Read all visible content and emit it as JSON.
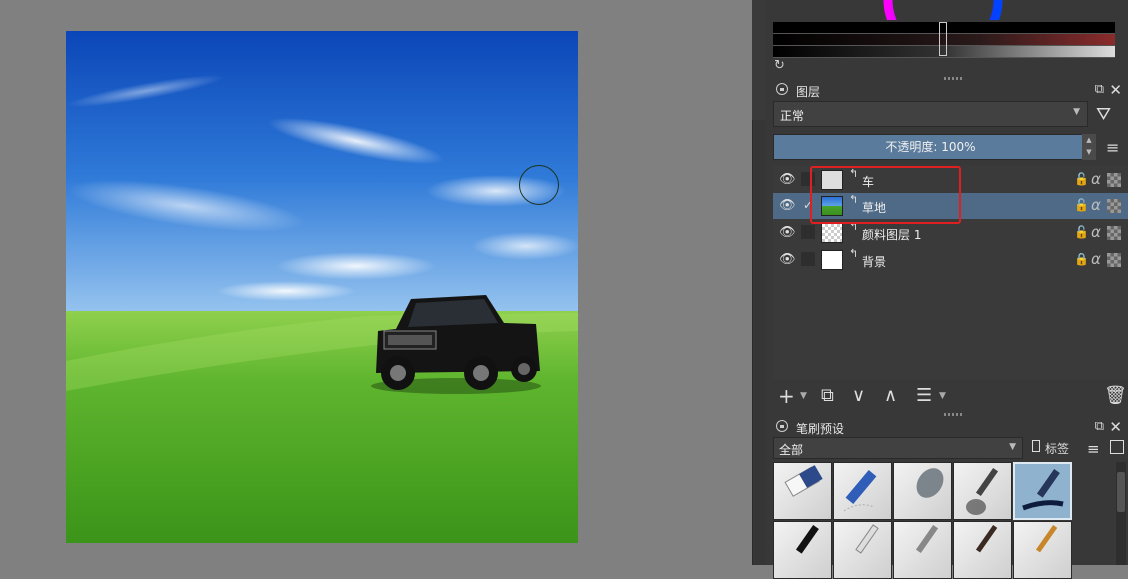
{
  "canvas": {
    "image_desc_colors": {
      "sky_top": "#0d4fc2",
      "sky_bottom": "#7fb6ea",
      "grass_top": "#6cc13a",
      "grass_bottom": "#3f9a1d"
    }
  },
  "layers_panel": {
    "title": "图层",
    "blend_mode": "正常",
    "opacity_label": "不透明度:  100%",
    "layers": [
      {
        "name": "车",
        "visible": true,
        "selected": false,
        "active_check": false
      },
      {
        "name": "草地",
        "visible": true,
        "selected": true,
        "active_check": true
      },
      {
        "name": "颜料图层 1",
        "visible": true,
        "selected": false,
        "active_check": false
      },
      {
        "name": "背景",
        "visible": true,
        "selected": false,
        "active_check": false
      }
    ],
    "toolbar_icons": [
      "add-layer-icon",
      "duplicate-layer-icon",
      "move-down-icon",
      "move-up-icon",
      "layer-properties-icon",
      "delete-layer-icon"
    ]
  },
  "brush_presets": {
    "title": "笔刷预设",
    "filter_value": "全部",
    "tag_label": "标签"
  },
  "colors": {
    "panel_bg": "#383838",
    "selected_row": "#4e6a86",
    "opacity_slider": "#5a7b9c",
    "highlight": "#e02020"
  }
}
